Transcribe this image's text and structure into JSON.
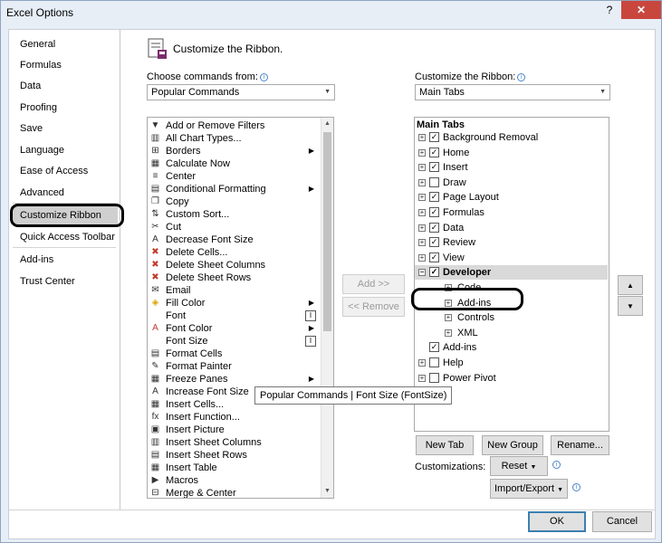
{
  "window": {
    "title": "Excel Options",
    "help": "?",
    "close": "✕"
  },
  "nav": {
    "items": [
      {
        "label": "General"
      },
      {
        "label": "Formulas"
      },
      {
        "label": "Data"
      },
      {
        "label": "Proofing"
      },
      {
        "label": "Save"
      },
      {
        "label": "Language"
      },
      {
        "label": "Ease of Access"
      },
      {
        "label": "Advanced"
      },
      {
        "label": "Customize Ribbon",
        "selected": true
      },
      {
        "label": "Quick Access Toolbar"
      },
      {
        "label": "Add-ins"
      },
      {
        "label": "Trust Center"
      }
    ]
  },
  "main": {
    "title": "Customize the Ribbon.",
    "choose_label": "Choose commands from:",
    "choose_value": "Popular Commands",
    "customize_label": "Customize the Ribbon:",
    "customize_value": "Main Tabs",
    "info": "i"
  },
  "commands": [
    {
      "label": "Add or Remove Filters",
      "icon": "filter-icon",
      "glyph": "▼"
    },
    {
      "label": "All Chart Types...",
      "icon": "chart-icon",
      "glyph": "▥"
    },
    {
      "label": "Borders",
      "icon": "borders-icon",
      "glyph": "⊞",
      "submenu": true
    },
    {
      "label": "Calculate Now",
      "icon": "calculator-icon",
      "glyph": "▦"
    },
    {
      "label": "Center",
      "icon": "center-align-icon",
      "glyph": "≡"
    },
    {
      "label": "Conditional Formatting",
      "icon": "conditional-format-icon",
      "glyph": "▤",
      "submenu": true
    },
    {
      "label": "Copy",
      "icon": "copy-icon",
      "glyph": "❐"
    },
    {
      "label": "Custom Sort...",
      "icon": "sort-icon",
      "glyph": "⇅"
    },
    {
      "label": "Cut",
      "icon": "scissors-icon",
      "glyph": "✂"
    },
    {
      "label": "Decrease Font Size",
      "icon": "decrease-font-icon",
      "glyph": "A"
    },
    {
      "label": "Delete Cells...",
      "icon": "delete-cells-icon",
      "glyph": "✖"
    },
    {
      "label": "Delete Sheet Columns",
      "icon": "delete-columns-icon",
      "glyph": "✖"
    },
    {
      "label": "Delete Sheet Rows",
      "icon": "delete-rows-icon",
      "glyph": "✖"
    },
    {
      "label": "Email",
      "icon": "email-icon",
      "glyph": "✉"
    },
    {
      "label": "Fill Color",
      "icon": "fill-color-icon",
      "glyph": "◈",
      "submenu": true
    },
    {
      "label": "Font",
      "icon": "",
      "glyph": "",
      "box": "I"
    },
    {
      "label": "Font Color",
      "icon": "font-color-icon",
      "glyph": "A",
      "submenu": true
    },
    {
      "label": "Font Size",
      "icon": "",
      "glyph": "",
      "box": "I"
    },
    {
      "label": "Format Cells",
      "icon": "format-cells-icon",
      "glyph": "▤"
    },
    {
      "label": "Format Painter",
      "icon": "format-painter-icon",
      "glyph": "✎"
    },
    {
      "label": "Freeze Panes",
      "icon": "freeze-panes-icon",
      "glyph": "▦",
      "submenu": true
    },
    {
      "label": "Increase Font Size",
      "icon": "increase-font-icon",
      "glyph": "A"
    },
    {
      "label": "Insert Cells...",
      "icon": "insert-cells-icon",
      "glyph": "▦"
    },
    {
      "label": "Insert Function...",
      "icon": "function-icon",
      "glyph": "fx"
    },
    {
      "label": "Insert Picture",
      "icon": "picture-icon",
      "glyph": "▣"
    },
    {
      "label": "Insert Sheet Columns",
      "icon": "insert-columns-icon",
      "glyph": "▥"
    },
    {
      "label": "Insert Sheet Rows",
      "icon": "insert-rows-icon",
      "glyph": "▤"
    },
    {
      "label": "Insert Table",
      "icon": "table-icon",
      "glyph": "▦"
    },
    {
      "label": "Macros",
      "icon": "macros-icon",
      "glyph": "▶"
    },
    {
      "label": "Merge & Center",
      "icon": "merge-icon",
      "glyph": "⊟"
    }
  ],
  "buttons": {
    "add": "Add >>",
    "remove": "<< Remove",
    "new_tab": "New Tab",
    "new_group": "New Group",
    "rename": "Rename...",
    "customizations_label": "Customizations:",
    "reset": "Reset",
    "import_export": "Import/Export",
    "ok": "OK",
    "cancel": "Cancel",
    "move_up": "▲",
    "move_down": "▼"
  },
  "tree": {
    "header": "Main Tabs",
    "items": [
      {
        "label": "Background Removal",
        "level": 0,
        "expander": "+",
        "checked": true
      },
      {
        "label": "Home",
        "level": 0,
        "expander": "+",
        "checked": true
      },
      {
        "label": "Insert",
        "level": 0,
        "expander": "+",
        "checked": true
      },
      {
        "label": "Draw",
        "level": 0,
        "expander": "+",
        "checked": false
      },
      {
        "label": "Page Layout",
        "level": 0,
        "expander": "+",
        "checked": true
      },
      {
        "label": "Formulas",
        "level": 0,
        "expander": "+",
        "checked": true
      },
      {
        "label": "Data",
        "level": 0,
        "expander": "+",
        "checked": true
      },
      {
        "label": "Review",
        "level": 0,
        "expander": "+",
        "checked": true
      },
      {
        "label": "View",
        "level": 0,
        "expander": "+",
        "checked": true
      },
      {
        "label": "Developer",
        "level": 0,
        "expander": "−",
        "checked": true,
        "selected": true
      },
      {
        "label": "Code",
        "level": 1,
        "expander": "+"
      },
      {
        "label": "Add-ins",
        "level": 1,
        "expander": "+"
      },
      {
        "label": "Controls",
        "level": 1,
        "expander": "+"
      },
      {
        "label": "XML",
        "level": 1,
        "expander": "+"
      },
      {
        "label": "Add-ins",
        "level": 0,
        "expander": "",
        "checked": true
      },
      {
        "label": "Help",
        "level": 0,
        "expander": "+",
        "checked": false
      },
      {
        "label": "Power Pivot",
        "level": 0,
        "expander": "+",
        "checked": false
      }
    ]
  },
  "tooltip": "Popular Commands | Font Size (FontSize)",
  "colors": {
    "accent": "#3c7fb1",
    "close": "#c9463d",
    "selection": "#cfcfcf"
  }
}
